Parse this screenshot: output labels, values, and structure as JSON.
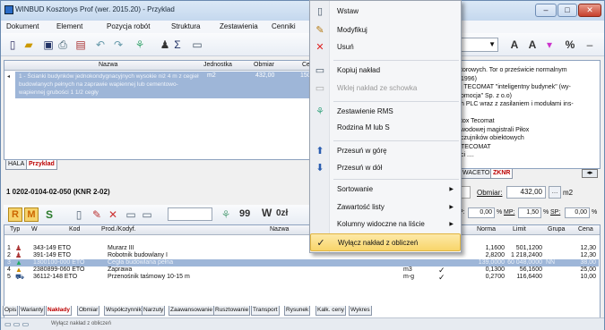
{
  "window": {
    "title": "WINBUD Kosztorys Prof (wer. 2015.20) - Przyklad"
  },
  "menu": [
    "Dokument",
    "Element",
    "Pozycja robót",
    "Struktura",
    "Zestawienia",
    "Cenniki"
  ],
  "top_grid": {
    "headers": [
      "Nazwa",
      "Jednostka",
      "Obmiar",
      "Cer"
    ],
    "row": {
      "name": "1 - Ścianki budynków jednokondygnacyjnych wysokie niż 4 m z cegieł budowlanych pełnych na zaprawie wapiennej lub cementowo-wapiennej grubości 1 1/2 cegły",
      "unit": "m2",
      "qty": "432,00",
      "price": "150"
    }
  },
  "upper_tabs": [
    "HALA",
    "Przyklad"
  ],
  "position_label": "1  0202-0104-02-050  (KNR 2-02)",
  "mid_toolbar": {
    "letters": [
      "R",
      "M",
      "S"
    ],
    "filter_labels": [
      "99",
      "W",
      "0zł"
    ]
  },
  "obmiar": {
    "label": "Obmiar:",
    "value": "432,00",
    "unit": "m2"
  },
  "percent_row": {
    "p1": "0,00",
    "mp_label": "MP:",
    "mp": "1,50",
    "sp_label": "SP:",
    "sp": "0,00"
  },
  "grid": {
    "headers": [
      "Typ",
      "W",
      "Kod",
      "Prod./Kodyf.",
      "Nazwa"
    ],
    "rows": [
      {
        "num": "1",
        "code": "343-149 ETO",
        "name": "Murarz III",
        "unit": "",
        "norma": "1,1600",
        "limit": "501,1200",
        "grupa": "",
        "cena": "12,30"
      },
      {
        "num": "2",
        "code": "391-149 ETO",
        "name": "Robotnik budowlany I",
        "unit": "",
        "norma": "2,8200",
        "limit": "1 218,2400",
        "grupa": "",
        "cena": "12,30"
      },
      {
        "num": "3",
        "code": "1300100-000 ETO",
        "name": "Cegła budowlana pełna",
        "unit": "",
        "norma": "139,0000",
        "limit": "60 048,0000",
        "grupa": "NN",
        "cena": "38,00"
      },
      {
        "num": "4",
        "code": "2380899-060 ETO",
        "name": "Zaprawa",
        "unit": "m3",
        "norma": "0,1300",
        "limit": "56,1600",
        "grupa": "",
        "cena": "25,00"
      },
      {
        "num": "5",
        "code": "36112-148 ETO",
        "name": "Przenośnik taśmowy 10-15 m",
        "unit": "m-g",
        "norma": "0,2700",
        "limit": "116,6400",
        "grupa": "",
        "cena": "10,00"
      }
    ],
    "right_headers": [
      "Norma",
      "Limit",
      "Grupa",
      "Cena"
    ]
  },
  "right_panel": {
    "lines": [
      "torowych. Tor o prześwicie normalnym",
      "1996)",
      "j TECOMAT \"inteligentny budynek\" (wy-",
      "omocja\" Sp. z o.o)",
      "h PLC wraz z zasilaniem i modułami ins-",
      "",
      "tox Tecomat",
      "wodowej magistrali Piłox",
      "czujników obiektowych",
      "TECOMAT",
      "ci ...."
    ],
    "tabs": [
      "WACETOB",
      "ZKNR"
    ]
  },
  "context_menu": [
    {
      "label": "Wstaw",
      "icon": "insert-icon",
      "enabled": true,
      "submenu": false
    },
    {
      "label": "Modyfikuj",
      "icon": "edit-icon",
      "enabled": true,
      "submenu": false
    },
    {
      "label": "Usuń",
      "icon": "delete-icon",
      "enabled": true,
      "submenu": false
    },
    {
      "label": "Kopiuj nakład",
      "icon": "copy-icon",
      "enabled": true,
      "submenu": false
    },
    {
      "label": "Wklej nakład ze schowka",
      "icon": "paste-icon",
      "enabled": false,
      "submenu": false
    },
    {
      "label": "Zestawienie RMS",
      "icon": "rms-icon",
      "enabled": true,
      "submenu": false
    },
    {
      "label": "Rodzina M lub S",
      "icon": "",
      "enabled": true,
      "submenu": false
    },
    {
      "label": "Przesuń w górę",
      "icon": "up-arrow-icon",
      "enabled": true,
      "submenu": false
    },
    {
      "label": "Przesuń w dół",
      "icon": "down-arrow-icon",
      "enabled": true,
      "submenu": false
    },
    {
      "label": "Sortowanie",
      "icon": "",
      "enabled": true,
      "submenu": true
    },
    {
      "label": "Zawartość listy",
      "icon": "",
      "enabled": true,
      "submenu": true
    },
    {
      "label": "Kolumny widoczne na liście",
      "icon": "",
      "enabled": true,
      "submenu": true
    },
    {
      "label": "Wyłącz nakład z obliczeń",
      "icon": "check-icon",
      "enabled": true,
      "submenu": false,
      "checked": true
    }
  ],
  "bottom_tabs": [
    "Opis",
    "Warianty",
    "Nakłady",
    "Obmiar",
    "Współczynniki",
    "Narzuty",
    "Zaawansowanie",
    "Rusztowanie",
    "Transport",
    "Rysunek",
    "Kalk. ceny",
    "Wykres"
  ],
  "status": {
    "text": "Wyłącz nakład z obliczeń"
  }
}
